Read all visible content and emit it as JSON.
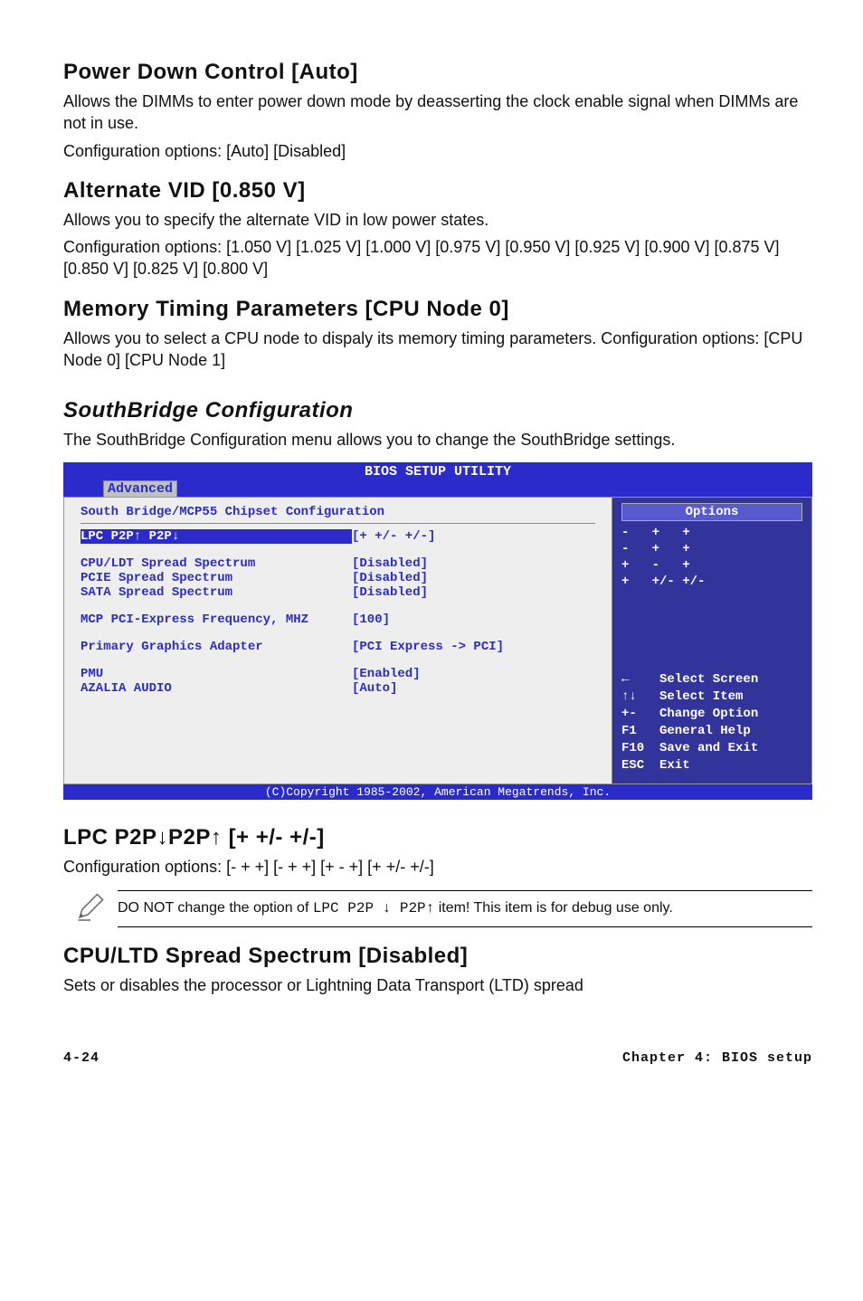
{
  "sec1": {
    "title": "Power Down Control [Auto]",
    "p1": "Allows the DIMMs to enter power down mode by deasserting the clock enable signal when DIMMs are not in use.",
    "p2": "Configuration options: [Auto] [Disabled]"
  },
  "sec2": {
    "title": "Alternate VID [0.850 V]",
    "p1": "Allows you to specify the alternate VID in low power states.",
    "p2": "Configuration options: [1.050 V] [1.025 V] [1.000 V] [0.975 V] [0.950 V] [0.925 V] [0.900 V] [0.875 V] [0.850 V] [0.825 V] [0.800 V]"
  },
  "sec3": {
    "title": "Memory Timing Parameters [CPU Node 0]",
    "p1": "Allows you to select a CPU node to dispaly its memory timing parameters. Configuration options: [CPU Node 0] [CPU Node 1]"
  },
  "sec4": {
    "title": "SouthBridge Configuration",
    "p1": "The SouthBridge Configuration menu allows you to change the SouthBridge settings."
  },
  "bios": {
    "titlebar": "BIOS SETUP UTILITY",
    "tab": "Advanced",
    "heading": "South Bridge/MCP55 Chipset Configuration",
    "rows": {
      "r0": {
        "label": "LPC P2P↑ P2P↓",
        "value": "[+ +/- +/-]"
      },
      "r1": {
        "label": "CPU/LDT Spread Spectrum",
        "value": "[Disabled]"
      },
      "r2": {
        "label": "PCIE Spread Spectrum",
        "value": "[Disabled]"
      },
      "r3": {
        "label": "SATA Spread Spectrum",
        "value": "[Disabled]"
      },
      "r4": {
        "label": "MCP PCI-Express Frequency, MHZ",
        "value": "[100]"
      },
      "r5": {
        "label": "Primary Graphics Adapter",
        "value": "[PCI Express -> PCI]"
      },
      "r6": {
        "label": "PMU",
        "value": "[Enabled]"
      },
      "r7": {
        "label": "AZALIA AUDIO",
        "value": "[Auto]"
      }
    },
    "help": {
      "title": "Options",
      "line1": "-   +   +",
      "line2": "-   +   +",
      "line3": "+   -   +",
      "line4": "+   +/- +/-"
    },
    "nav": {
      "n1": {
        "k": "←",
        "t": "Select Screen"
      },
      "n2": {
        "k": "↑↓",
        "t": "Select Item"
      },
      "n3": {
        "k": "+-",
        "t": "Change Option"
      },
      "n4": {
        "k": "F1",
        "t": "General Help"
      },
      "n5": {
        "k": "F10",
        "t": "Save and Exit"
      },
      "n6": {
        "k": "ESC",
        "t": "Exit"
      }
    },
    "footer": "(C)Copyright 1985-2002, American Megatrends, Inc."
  },
  "sec5": {
    "title": "LPC P2P↓P2P↑ [+ +/- +/-]",
    "p1": "Configuration options: [- + +] [- + +] [+ - +] [+ +/- +/-]"
  },
  "note": {
    "pre": "DO NOT change the option of ",
    "mono": "LPC P2P ↓ P2P↑",
    "post": " item! This item is for debug use only."
  },
  "sec6": {
    "title": "CPU/LTD Spread Spectrum [Disabled]",
    "p1": "Sets or disables the processor or Lightning Data Transport (LTD) spread"
  },
  "footer": {
    "pnum": "4-24",
    "pchap": "Chapter 4: BIOS setup"
  }
}
